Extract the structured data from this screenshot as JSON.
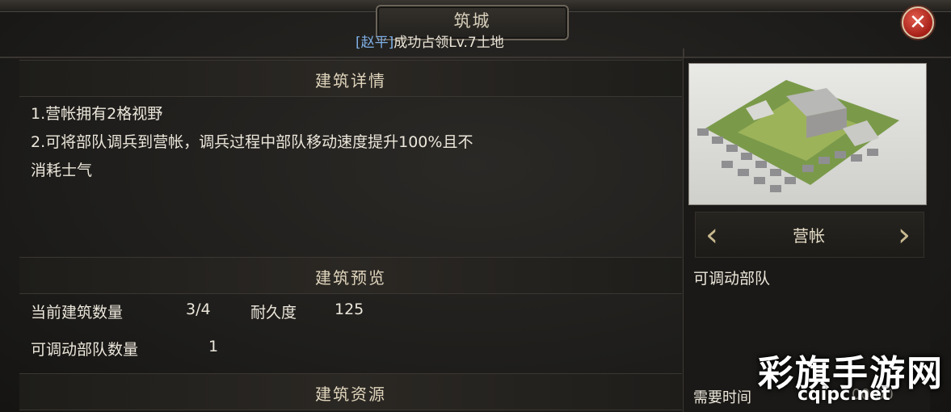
{
  "window": {
    "title": "筑城",
    "notice_name": "[赵平]",
    "notice_text": "成功占领Lv.7土地",
    "close_symbol": "✕"
  },
  "details": {
    "heading": "建筑详情",
    "lines": [
      "1.营帐拥有2格视野",
      "2.可将部队调兵到营帐，调兵过程中部队移动速度提升100%且不",
      "消耗士气"
    ]
  },
  "preview": {
    "heading": "建筑预览",
    "count_label": "当前建筑数量",
    "count_value": "3/4",
    "durability_label": "耐久度",
    "durability_value": "125",
    "troops_label": "可调动部队数量",
    "troops_value": "1"
  },
  "resources": {
    "heading": "建筑资源"
  },
  "side": {
    "building_name": "营帐",
    "prev_icon": "chevron-left-icon",
    "next_icon": "chevron-right-icon",
    "description": "可调动部队",
    "time_label": "需要时间",
    "time_value": "00:00"
  },
  "watermark": {
    "main": "彩旗手游网",
    "url": "cqipc.net"
  },
  "colors": {
    "highlight_name": "#7fb0e6",
    "close_red": "#c0281e",
    "accent_gold": "#c8b98f"
  }
}
